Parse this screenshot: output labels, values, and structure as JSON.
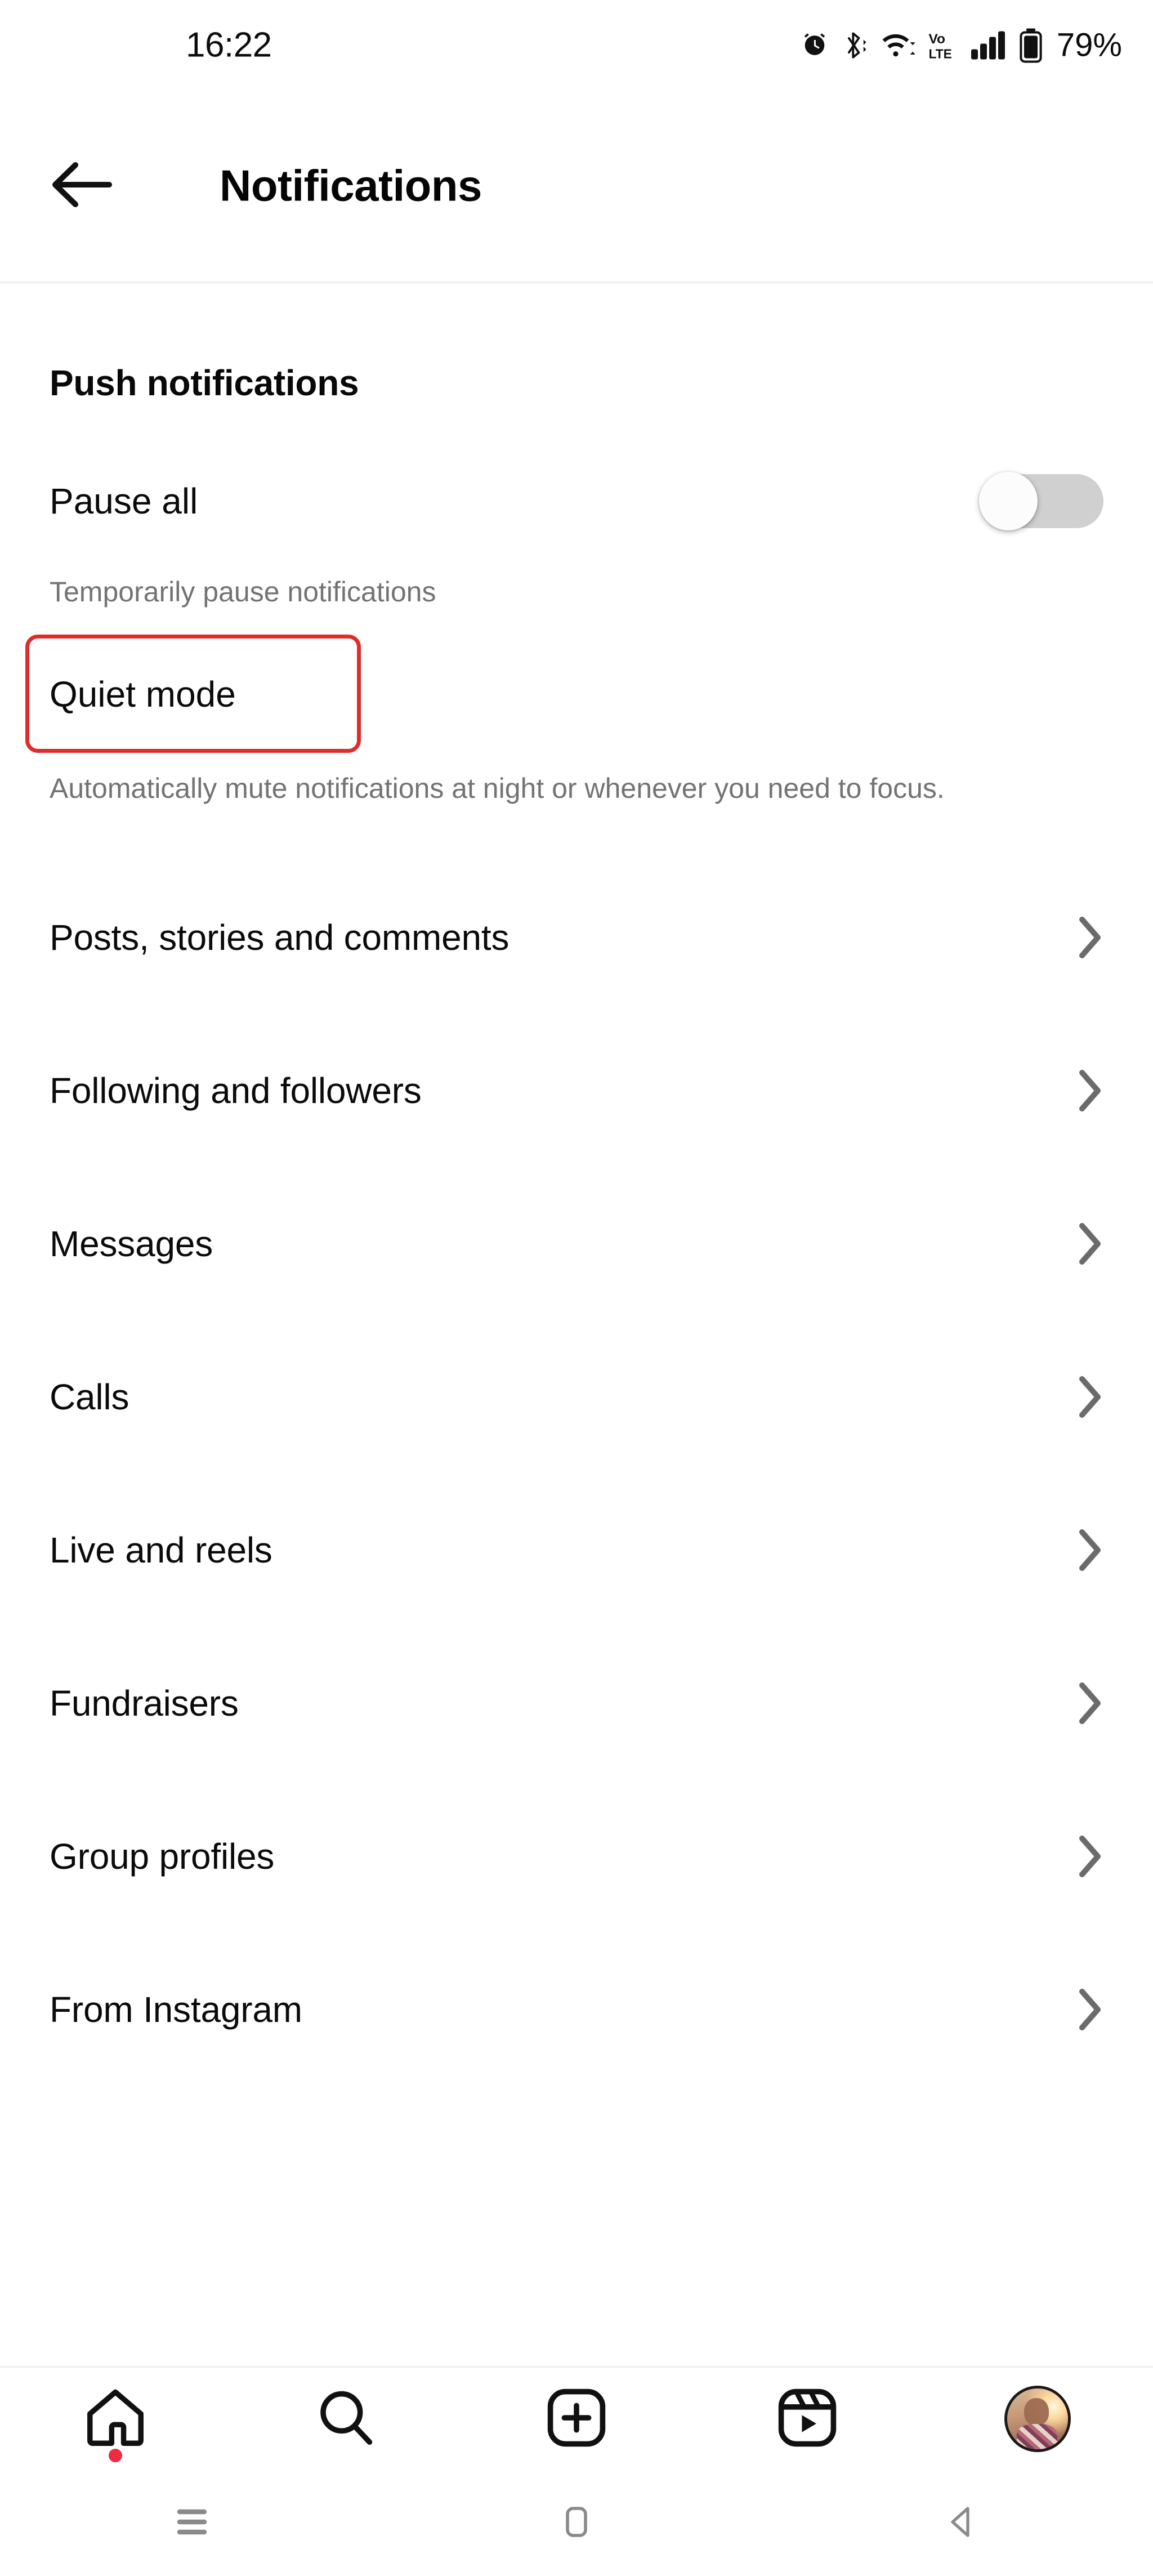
{
  "status_bar": {
    "time": "16:22",
    "battery_percent": "79%",
    "icons": [
      "alarm-icon",
      "bluetooth-icon",
      "wifi-icon",
      "volte-icon",
      "signal-icon",
      "battery-icon"
    ],
    "volte_top": "Vo",
    "volte_bottom": "LTE"
  },
  "header": {
    "back_icon": "back-arrow-icon",
    "title": "Notifications"
  },
  "main": {
    "section_title": "Push notifications",
    "pause_all": {
      "label": "Pause all",
      "helper": "Temporarily pause notifications",
      "toggle_state": "off"
    },
    "quiet_mode": {
      "label": "Quiet mode",
      "description": "Automatically mute notifications at night or whenever you need to focus.",
      "highlight_color": "#e02b2b",
      "highlighted": true
    },
    "nav_items": [
      {
        "label": "Posts, stories and comments",
        "icon": "chevron-right-icon"
      },
      {
        "label": "Following and followers",
        "icon": "chevron-right-icon"
      },
      {
        "label": "Messages",
        "icon": "chevron-right-icon"
      },
      {
        "label": "Calls",
        "icon": "chevron-right-icon"
      },
      {
        "label": "Live and reels",
        "icon": "chevron-right-icon"
      },
      {
        "label": "Fundraisers",
        "icon": "chevron-right-icon"
      },
      {
        "label": "Group profiles",
        "icon": "chevron-right-icon"
      },
      {
        "label": "From Instagram",
        "icon": "chevron-right-icon"
      }
    ]
  },
  "bottom_nav": {
    "items": [
      {
        "name": "home",
        "icon": "home-icon",
        "badge": true
      },
      {
        "name": "search",
        "icon": "search-icon",
        "badge": false
      },
      {
        "name": "create",
        "icon": "plus-square-icon",
        "badge": false
      },
      {
        "name": "reels",
        "icon": "reels-icon",
        "badge": false
      },
      {
        "name": "profile",
        "icon": "avatar-icon",
        "badge": false
      }
    ],
    "badge_color": "#ed2b41"
  },
  "system_nav": {
    "items": [
      {
        "name": "recents",
        "icon": "recents-icon"
      },
      {
        "name": "home",
        "icon": "home-square-icon"
      },
      {
        "name": "back",
        "icon": "back-triangle-icon"
      }
    ]
  }
}
